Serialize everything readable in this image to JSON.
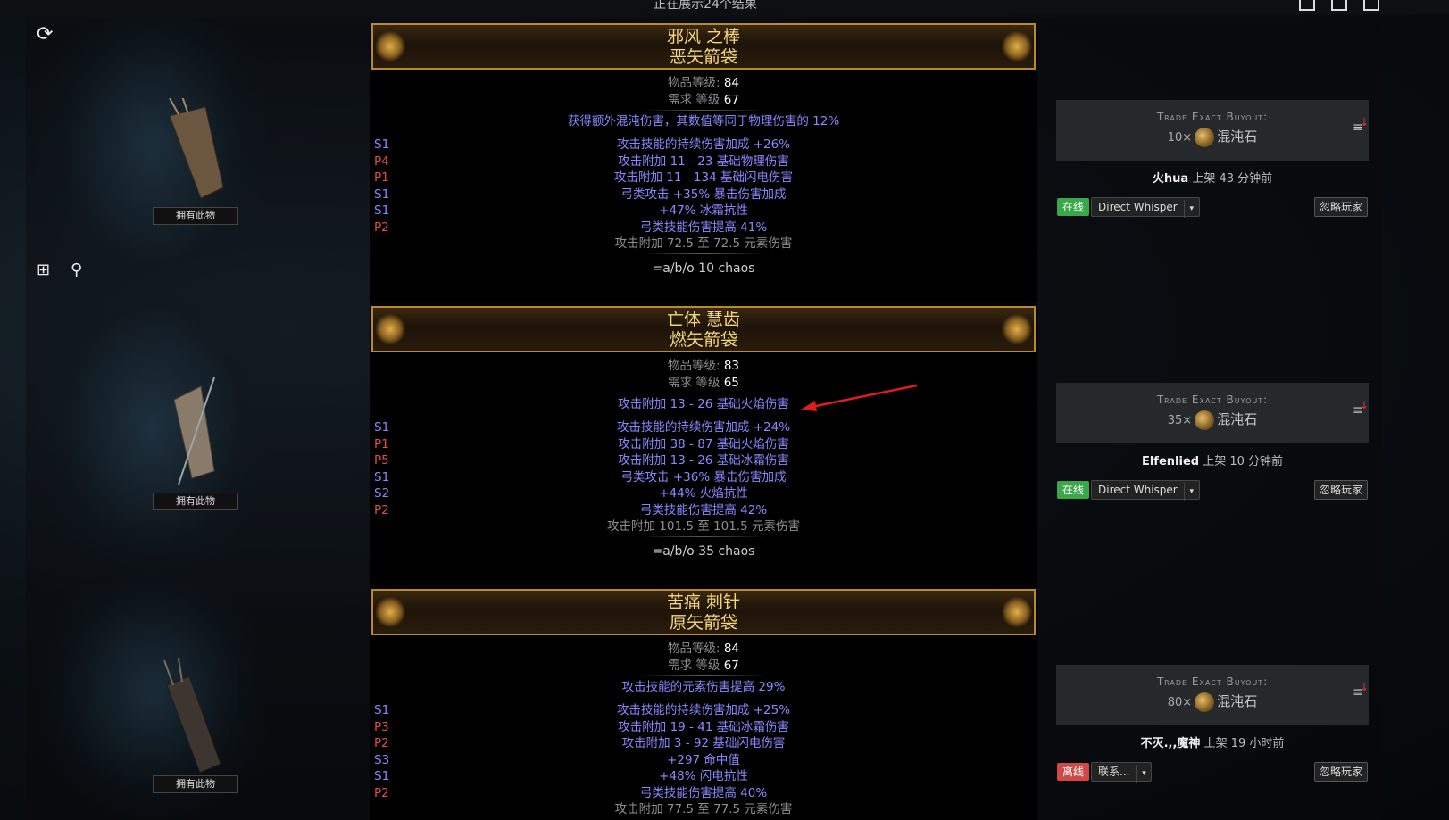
{
  "topbar": {
    "count_text": "正在展示24个结果"
  },
  "tooltips": {
    "owned": "拥有此物"
  },
  "items": [
    {
      "name_line1": "邪风 之棒",
      "name_line2": "恶矢箭袋",
      "item_level_label": "物品等级:",
      "item_level": "84",
      "req_level_label": "需求 等级",
      "req_level": "67",
      "implicit": "获得额外混沌伤害，其数值等同于物理伤害的 12%",
      "mods": [
        {
          "tier": "S1",
          "kind": "s",
          "text": "攻击技能的持续伤害加成 +26%"
        },
        {
          "tier": "P4",
          "kind": "p",
          "text": "攻击附加 11 - 23 基础物理伤害"
        },
        {
          "tier": "P1",
          "kind": "p",
          "text": "攻击附加 11 - 134 基础闪电伤害"
        },
        {
          "tier": "S1",
          "kind": "s",
          "text": "弓类攻击 +35% 暴击伤害加成"
        },
        {
          "tier": "S1",
          "kind": "s",
          "text": "+47% 冰霜抗性"
        },
        {
          "tier": "P2",
          "kind": "p",
          "text": "弓类技能伤害提高 41%"
        }
      ],
      "pseudo": "攻击附加 72.5 至 72.5 元素伤害",
      "note": "=a/b/o 10 chaos",
      "trade": {
        "title": "Trade Exact Buyout:",
        "qty": "10×",
        "currency": "混沌石"
      },
      "seller": {
        "name": "火hua",
        "listed": "上架 43 分钟前"
      },
      "status": "在线",
      "status_kind": "online",
      "whisper": "Direct Whisper",
      "ignore": "忽略玩家"
    },
    {
      "name_line1": "亡体 慧齿",
      "name_line2": "燃矢箭袋",
      "item_level_label": "物品等级:",
      "item_level": "83",
      "req_level_label": "需求 等级",
      "req_level": "65",
      "implicit": "攻击附加 13 - 26 基础火焰伤害",
      "mods": [
        {
          "tier": "S1",
          "kind": "s",
          "text": "攻击技能的持续伤害加成 +24%"
        },
        {
          "tier": "P1",
          "kind": "p",
          "text": "攻击附加 38 - 87 基础火焰伤害"
        },
        {
          "tier": "P5",
          "kind": "p",
          "text": "攻击附加 13 - 26 基础冰霜伤害"
        },
        {
          "tier": "S1",
          "kind": "s",
          "text": "弓类攻击 +36% 暴击伤害加成"
        },
        {
          "tier": "S2",
          "kind": "s",
          "text": "+44% 火焰抗性"
        },
        {
          "tier": "P2",
          "kind": "p",
          "text": "弓类技能伤害提高 42%"
        }
      ],
      "pseudo": "攻击附加 101.5 至 101.5 元素伤害",
      "note": "=a/b/o 35 chaos",
      "trade": {
        "title": "Trade Exact Buyout:",
        "qty": "35×",
        "currency": "混沌石"
      },
      "seller": {
        "name": "Elfenlied",
        "listed": "上架 10 分钟前"
      },
      "status": "在线",
      "status_kind": "online",
      "whisper": "Direct Whisper",
      "ignore": "忽略玩家"
    },
    {
      "name_line1": "苦痛 刺针",
      "name_line2": "原矢箭袋",
      "item_level_label": "物品等级:",
      "item_level": "84",
      "req_level_label": "需求 等级",
      "req_level": "67",
      "implicit": "攻击技能的元素伤害提高 29%",
      "mods": [
        {
          "tier": "S1",
          "kind": "s",
          "text": "攻击技能的持续伤害加成 +25%"
        },
        {
          "tier": "P3",
          "kind": "p",
          "text": "攻击附加 19 - 41 基础冰霜伤害"
        },
        {
          "tier": "P2",
          "kind": "p",
          "text": "攻击附加 3 - 92 基础闪电伤害"
        },
        {
          "tier": "S3",
          "kind": "s",
          "text": "+297 命中值"
        },
        {
          "tier": "S1",
          "kind": "s",
          "text": "+48% 闪电抗性"
        },
        {
          "tier": "P2",
          "kind": "p",
          "text": "弓类技能伤害提高 40%"
        }
      ],
      "pseudo": "攻击附加 77.5 至 77.5 元素伤害",
      "note": "",
      "trade": {
        "title": "Trade Exact Buyout:",
        "qty": "80×",
        "currency": "混沌石"
      },
      "seller": {
        "name": "不灭.,,魔神",
        "listed": "上架 19 小时前"
      },
      "status": "离线",
      "status_kind": "offline",
      "whisper": "联系...",
      "ignore": "忽略玩家"
    }
  ],
  "icons": [
    "refresh-icon",
    "add-to-list-icon",
    "search-user-icon",
    "sort-icon",
    "chaos-orb-icon"
  ],
  "colors": {
    "gold": "#f3d67a",
    "magic_mod": "#8888ff",
    "prefix": "#e0504a",
    "online": "#3aa84a",
    "offline": "#d04848"
  }
}
